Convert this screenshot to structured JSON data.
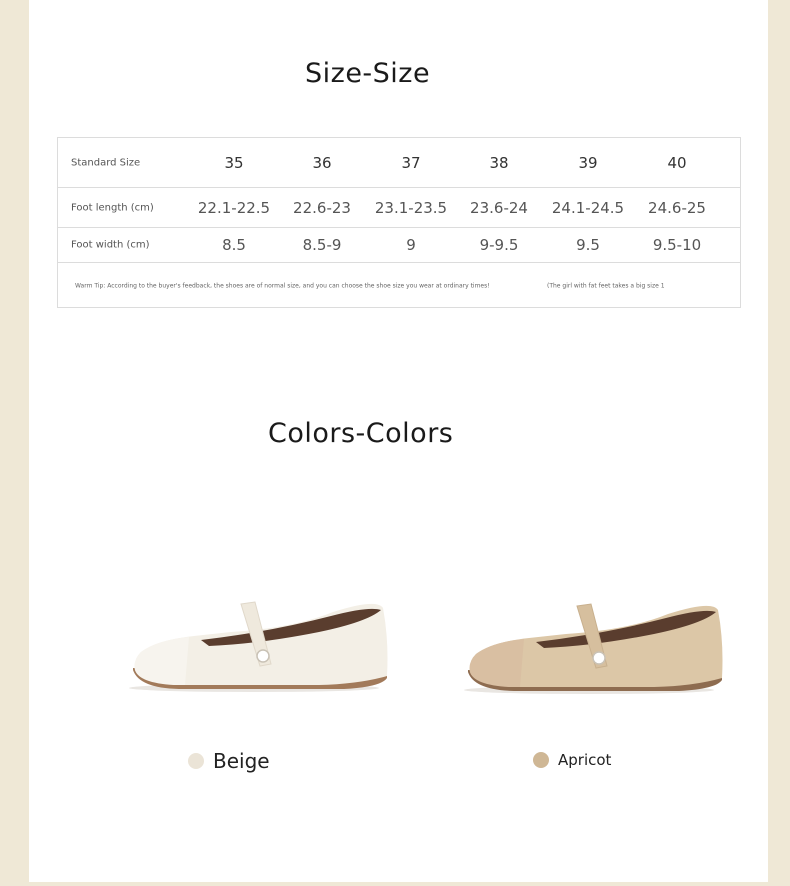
{
  "size_section": {
    "title": "Size-Size",
    "table": {
      "rows": [
        {
          "label": "Standard Size",
          "values": [
            "35",
            "36",
            "37",
            "38",
            "39",
            "40"
          ]
        },
        {
          "label": "Foot length (cm)",
          "values": [
            "22.1-22.5",
            "22.6-23",
            "23.1-23.5",
            "23.6-24",
            "24.1-24.5",
            "24.6-25"
          ]
        },
        {
          "label": "Foot width (cm)",
          "values": [
            "8.5",
            "8.5-9",
            "9",
            "9-9.5",
            "9.5",
            "9.5-10"
          ]
        }
      ],
      "warm_tip": "Warm Tip: According to the buyer's feedback, the shoes are of normal size, and you can choose the shoe size you wear at ordinary times!",
      "fat_feet_tip": "(The girl with fat feet takes a big size 1"
    }
  },
  "colors_section": {
    "title": "Colors-Colors",
    "options": [
      {
        "label": "Beige",
        "swatch": "#ebe4d7",
        "upper": "#f3efe6",
        "toe": "#f7f4ee",
        "sole": "#a27a5a"
      },
      {
        "label": "Apricot",
        "swatch": "#cfb795",
        "upper": "#dcc7a7",
        "toe": "#d9bfa2",
        "sole": "#8e6c50"
      }
    ]
  },
  "theme": {
    "background": "#efe8d6",
    "panel": "#ffffff",
    "border": "#dcdcdc"
  }
}
